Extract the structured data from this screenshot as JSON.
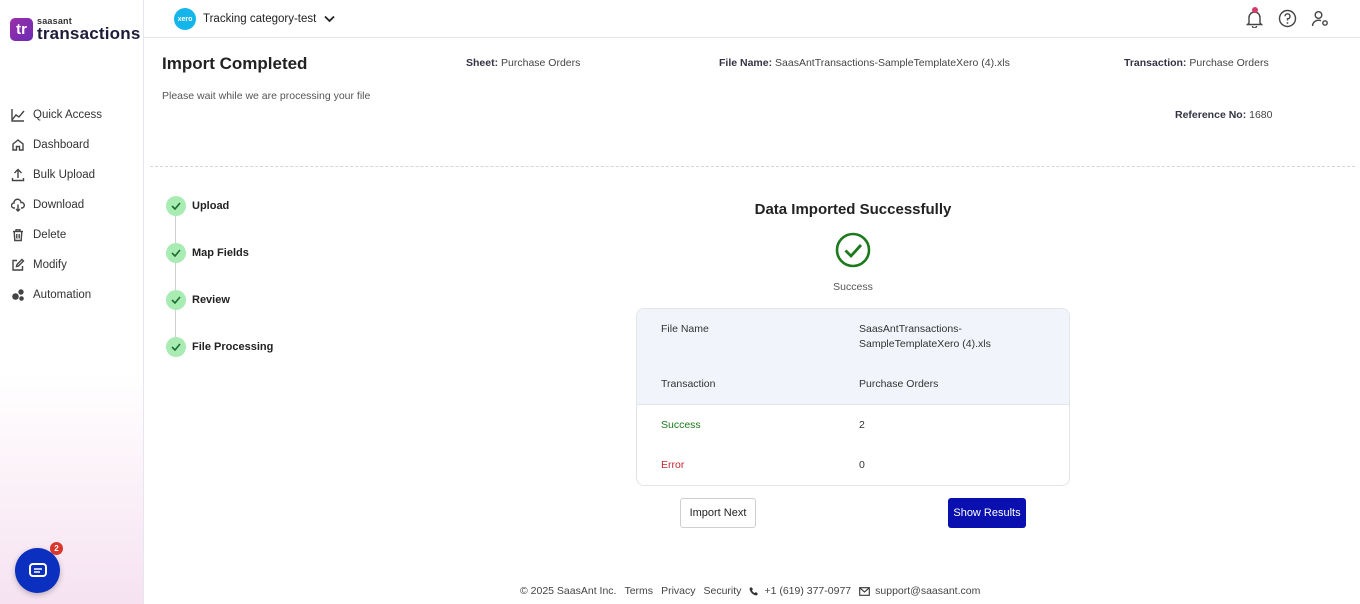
{
  "brand": {
    "small": "saasant",
    "big": "transactions",
    "mark": "tr"
  },
  "sidebar": {
    "items": [
      {
        "label": "Quick Access",
        "icon": "chart-line-icon"
      },
      {
        "label": "Dashboard",
        "icon": "home-icon"
      },
      {
        "label": "Bulk Upload",
        "icon": "upload-icon"
      },
      {
        "label": "Download",
        "icon": "cloud-download-icon"
      },
      {
        "label": "Delete",
        "icon": "trash-icon"
      },
      {
        "label": "Modify",
        "icon": "edit-icon"
      },
      {
        "label": "Automation",
        "icon": "gears-icon"
      }
    ]
  },
  "chat": {
    "badge": "2"
  },
  "topbar": {
    "org_logo": "xero",
    "org_name": "Tracking category-test"
  },
  "header": {
    "title": "Import Completed",
    "subtitle": "Please wait while we are processing your file",
    "sheet_label": "Sheet:",
    "sheet_value": "Purchase Orders",
    "file_label": "File Name:",
    "file_value": "SaasAntTransactions-SampleTemplateXero (4).xls",
    "txn_label": "Transaction:",
    "txn_value": "Purchase Orders",
    "ref_label": "Reference No:",
    "ref_value": "1680"
  },
  "steps": [
    "Upload",
    "Map Fields",
    "Review",
    "File Processing"
  ],
  "result": {
    "title": "Data Imported Successfully",
    "status": "Success",
    "file_name_label": "File Name",
    "file_name_value_1": "SaasAntTransactions-",
    "file_name_value_2": "SampleTemplateXero (4).xls",
    "transaction_label": "Transaction",
    "transaction_value": "Purchase Orders",
    "success_label": "Success",
    "success_value": "2",
    "error_label": "Error",
    "error_value": "0"
  },
  "buttons": {
    "import_next": "Import Next",
    "show_results": "Show Results"
  },
  "footer": {
    "copyright": "© 2025 SaasAnt Inc.",
    "terms": "Terms",
    "privacy": "Privacy",
    "security": "Security",
    "phone": "+1 (619) 377-0977",
    "email": "support@saasant.com"
  },
  "colors": {
    "primary_button": "#0a10b0",
    "success_green": "#1a7a1a",
    "error_red": "#c0262e",
    "step_check": "#a8ecb3"
  }
}
